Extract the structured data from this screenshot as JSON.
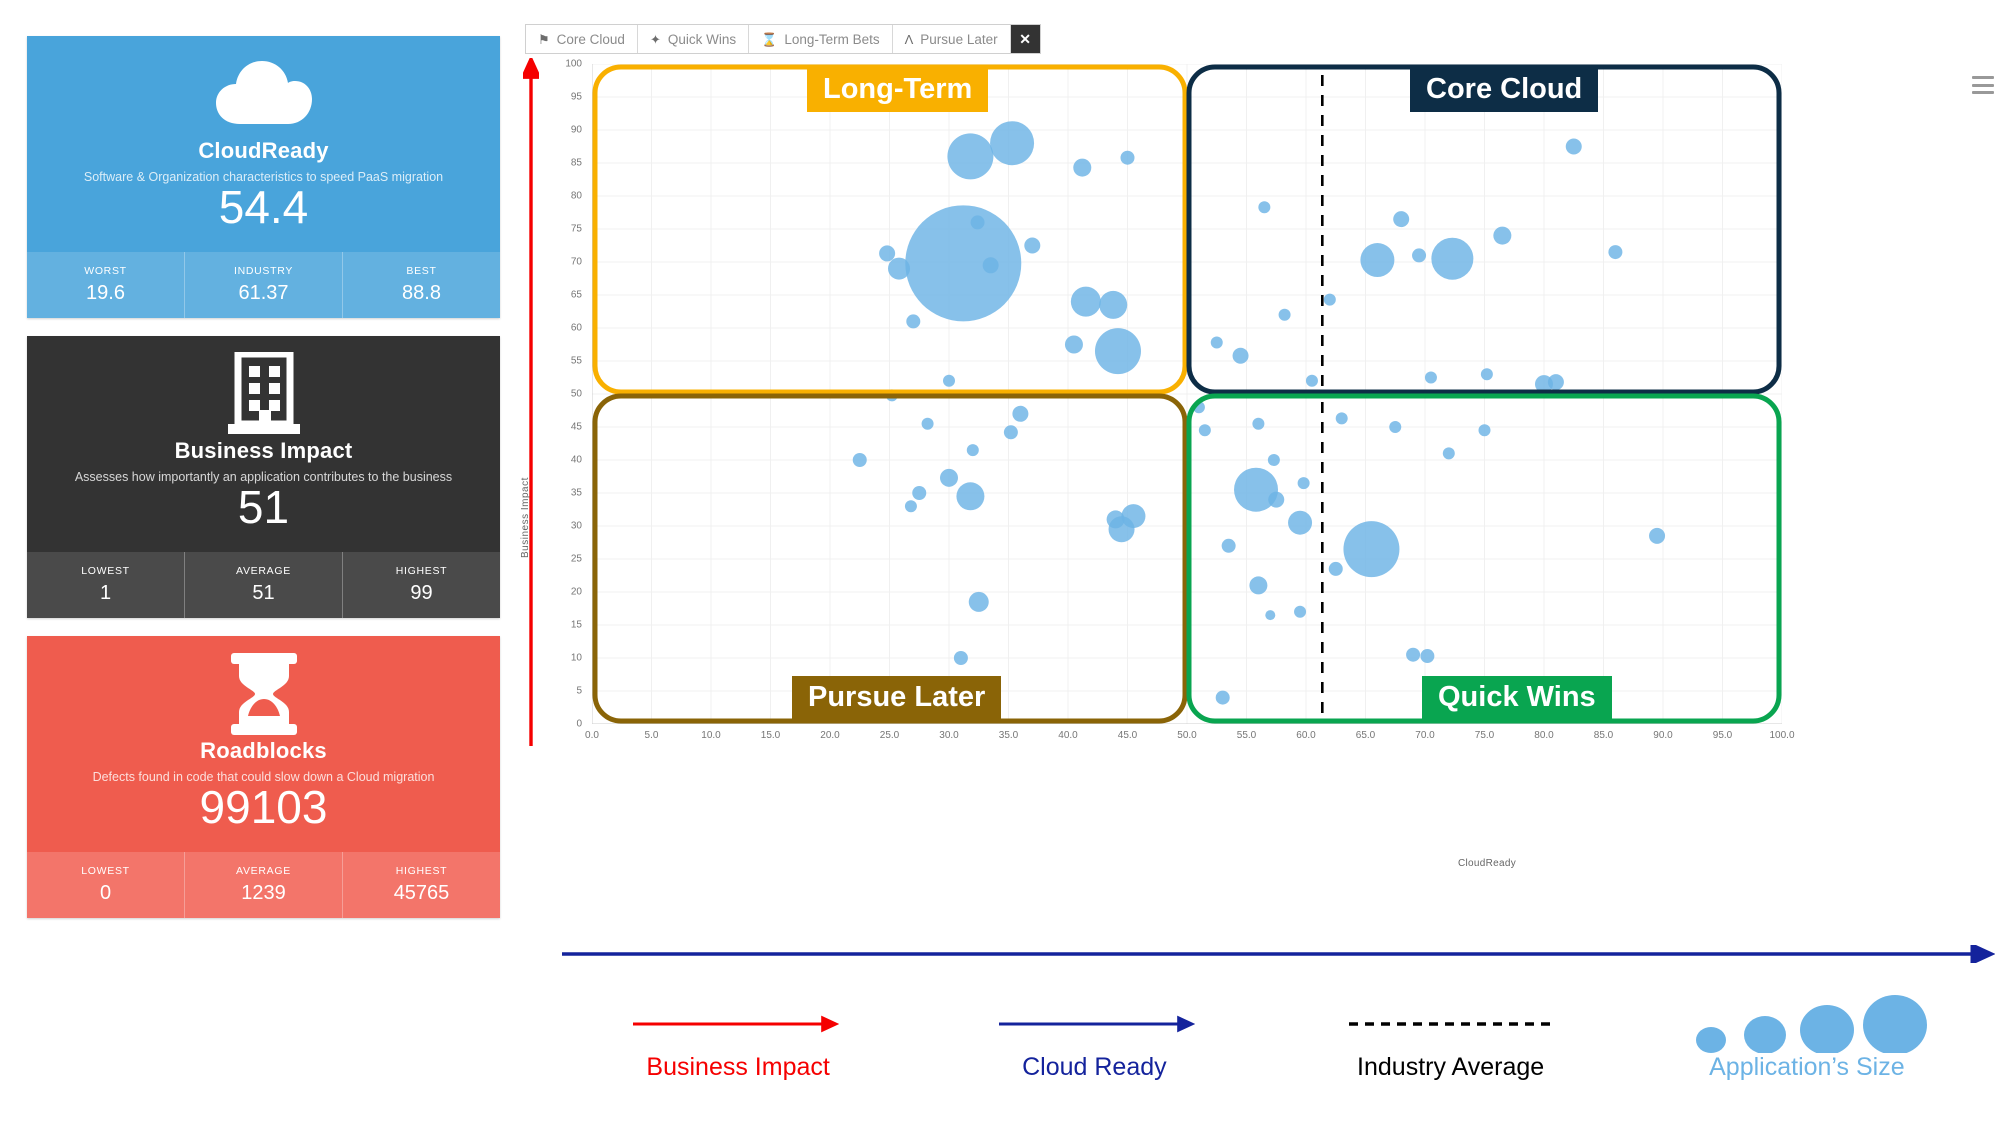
{
  "cards": [
    {
      "id": "cloudready",
      "icon": "cloud-icon",
      "title": "CloudReady",
      "subtitle": "Software & Organization characteristics to speed PaaS migration",
      "value": "54.4",
      "color": "#49a4db",
      "stats": [
        {
          "label": "WORST",
          "value": "19.6"
        },
        {
          "label": "INDUSTRY",
          "value": "61.37"
        },
        {
          "label": "BEST",
          "value": "88.8"
        }
      ]
    },
    {
      "id": "business-impact",
      "icon": "building-icon",
      "title": "Business Impact",
      "subtitle": "Assesses how importantly an application contributes to the business",
      "value": "51",
      "color": "#333333",
      "stats": [
        {
          "label": "LOWEST",
          "value": "1"
        },
        {
          "label": "AVERAGE",
          "value": "51"
        },
        {
          "label": "HIGHEST",
          "value": "99"
        }
      ]
    },
    {
      "id": "roadblocks",
      "icon": "hourglass-icon",
      "title": "Roadblocks",
      "subtitle": "Defects found in code that could slow down a Cloud migration",
      "value": "99103",
      "color": "#ef5c4e",
      "stats": [
        {
          "label": "LOWEST",
          "value": "0"
        },
        {
          "label": "AVERAGE",
          "value": "1239"
        },
        {
          "label": "HIGHEST",
          "value": "45765"
        }
      ]
    }
  ],
  "toolbar": {
    "buttons": [
      {
        "icon": "flag-icon",
        "glyph": "⚑",
        "label": "Core Cloud"
      },
      {
        "icon": "magic-wand-icon",
        "glyph": "✦",
        "label": "Quick Wins"
      },
      {
        "icon": "hourglass-icon",
        "glyph": "⌛",
        "label": "Long-Term Bets"
      },
      {
        "icon": "binoculars-icon",
        "glyph": "Ʌ",
        "label": "Pursue Later"
      }
    ],
    "close_label": "✕"
  },
  "chart_data": {
    "type": "scatter",
    "title": "",
    "xlabel": "CloudReady",
    "ylabel": "Business Impact",
    "xlim": [
      0,
      100
    ],
    "ylim": [
      0,
      100
    ],
    "grid": true,
    "xticks": [
      "0.0",
      "5.0",
      "10.0",
      "15.0",
      "20.0",
      "25.0",
      "30.0",
      "35.0",
      "40.0",
      "45.0",
      "50.0",
      "55.0",
      "60.0",
      "65.0",
      "70.0",
      "75.0",
      "80.0",
      "85.0",
      "90.0",
      "95.0",
      "100.0"
    ],
    "yticks": [
      "0",
      "5",
      "10",
      "15",
      "20",
      "25",
      "30",
      "35",
      "40",
      "45",
      "50",
      "55",
      "60",
      "65",
      "70",
      "75",
      "80",
      "85",
      "90",
      "95",
      "100"
    ],
    "industry_average_x": 61.37,
    "bubble_color": "#6cb3e5",
    "quadrants": [
      {
        "id": "long-term",
        "label": "Long-Term",
        "color": "#f9b000",
        "x_range": [
          0,
          50
        ],
        "y_range": [
          50,
          100
        ]
      },
      {
        "id": "core-cloud",
        "label": "Core Cloud",
        "color": "#0d2d46",
        "x_range": [
          50,
          100
        ],
        "y_range": [
          50,
          100
        ]
      },
      {
        "id": "pursue-later",
        "label": "Pursue Later",
        "color": "#8a6407",
        "x_range": [
          0,
          50
        ],
        "y_range": [
          0,
          50
        ]
      },
      {
        "id": "quick-wins",
        "label": "Quick Wins",
        "color": "#09a550",
        "x_range": [
          50,
          100
        ],
        "y_range": [
          0,
          50
        ]
      }
    ],
    "points": [
      {
        "x": 31.8,
        "y": 86.0,
        "r": 23
      },
      {
        "x": 35.3,
        "y": 88.0,
        "r": 22
      },
      {
        "x": 41.2,
        "y": 84.3,
        "r": 9
      },
      {
        "x": 45.0,
        "y": 85.8,
        "r": 7
      },
      {
        "x": 32.4,
        "y": 76.0,
        "r": 7
      },
      {
        "x": 31.2,
        "y": 69.8,
        "r": 58
      },
      {
        "x": 37.0,
        "y": 72.5,
        "r": 8
      },
      {
        "x": 24.8,
        "y": 71.3,
        "r": 8
      },
      {
        "x": 25.8,
        "y": 69.0,
        "r": 11
      },
      {
        "x": 33.5,
        "y": 69.5,
        "r": 8
      },
      {
        "x": 41.5,
        "y": 64.0,
        "r": 15
      },
      {
        "x": 43.8,
        "y": 63.5,
        "r": 14
      },
      {
        "x": 27.0,
        "y": 61.0,
        "r": 7
      },
      {
        "x": 44.2,
        "y": 56.5,
        "r": 23
      },
      {
        "x": 40.5,
        "y": 57.5,
        "r": 9
      },
      {
        "x": 30.0,
        "y": 52.0,
        "r": 6
      },
      {
        "x": 25.2,
        "y": 49.8,
        "r": 6
      },
      {
        "x": 36.0,
        "y": 47.0,
        "r": 8
      },
      {
        "x": 35.2,
        "y": 44.2,
        "r": 7
      },
      {
        "x": 28.2,
        "y": 45.5,
        "r": 6
      },
      {
        "x": 22.5,
        "y": 40.0,
        "r": 7
      },
      {
        "x": 32.0,
        "y": 41.5,
        "r": 6
      },
      {
        "x": 30.0,
        "y": 37.3,
        "r": 9
      },
      {
        "x": 27.5,
        "y": 35.0,
        "r": 7
      },
      {
        "x": 31.8,
        "y": 34.5,
        "r": 14
      },
      {
        "x": 26.8,
        "y": 33.0,
        "r": 6
      },
      {
        "x": 44.0,
        "y": 31.0,
        "r": 9
      },
      {
        "x": 45.5,
        "y": 31.5,
        "r": 12
      },
      {
        "x": 44.5,
        "y": 29.5,
        "r": 13
      },
      {
        "x": 32.5,
        "y": 18.5,
        "r": 10
      },
      {
        "x": 31.0,
        "y": 10.0,
        "r": 7
      },
      {
        "x": 51.5,
        "y": 44.5,
        "r": 6
      },
      {
        "x": 55.8,
        "y": 35.5,
        "r": 22
      },
      {
        "x": 57.5,
        "y": 34.0,
        "r": 8
      },
      {
        "x": 59.8,
        "y": 36.5,
        "r": 6
      },
      {
        "x": 59.5,
        "y": 30.5,
        "r": 12
      },
      {
        "x": 65.5,
        "y": 26.5,
        "r": 28
      },
      {
        "x": 53.5,
        "y": 27.0,
        "r": 7
      },
      {
        "x": 56.0,
        "y": 21.0,
        "r": 9
      },
      {
        "x": 62.5,
        "y": 23.5,
        "r": 7
      },
      {
        "x": 59.5,
        "y": 17.0,
        "r": 6
      },
      {
        "x": 69.0,
        "y": 10.5,
        "r": 7
      },
      {
        "x": 70.2,
        "y": 10.3,
        "r": 7
      },
      {
        "x": 53.0,
        "y": 4.0,
        "r": 7
      },
      {
        "x": 89.5,
        "y": 28.5,
        "r": 8
      },
      {
        "x": 51.0,
        "y": 48.0,
        "r": 6
      },
      {
        "x": 60.5,
        "y": 52.0,
        "r": 6
      },
      {
        "x": 70.5,
        "y": 52.5,
        "r": 6
      },
      {
        "x": 80.0,
        "y": 51.5,
        "r": 9
      },
      {
        "x": 81.0,
        "y": 51.8,
        "r": 8
      },
      {
        "x": 75.2,
        "y": 53.0,
        "r": 6
      },
      {
        "x": 54.5,
        "y": 55.8,
        "r": 8
      },
      {
        "x": 52.5,
        "y": 57.8,
        "r": 6
      },
      {
        "x": 58.2,
        "y": 62.0,
        "r": 6
      },
      {
        "x": 62.0,
        "y": 64.3,
        "r": 6
      },
      {
        "x": 66.0,
        "y": 70.3,
        "r": 17
      },
      {
        "x": 69.5,
        "y": 71.0,
        "r": 7
      },
      {
        "x": 72.3,
        "y": 70.5,
        "r": 21
      },
      {
        "x": 86.0,
        "y": 71.5,
        "r": 7
      },
      {
        "x": 76.5,
        "y": 74.0,
        "r": 9
      },
      {
        "x": 68.0,
        "y": 76.5,
        "r": 8
      },
      {
        "x": 56.5,
        "y": 78.3,
        "r": 6
      },
      {
        "x": 82.5,
        "y": 87.5,
        "r": 8
      },
      {
        "x": 56.0,
        "y": 45.5,
        "r": 6
      },
      {
        "x": 63.0,
        "y": 46.3,
        "r": 6
      },
      {
        "x": 67.5,
        "y": 45.0,
        "r": 6
      },
      {
        "x": 75.0,
        "y": 44.5,
        "r": 6
      },
      {
        "x": 72.0,
        "y": 41.0,
        "r": 6
      },
      {
        "x": 57.3,
        "y": 40.0,
        "r": 6
      },
      {
        "x": 57.0,
        "y": 16.5,
        "r": 5
      }
    ]
  },
  "legend": [
    {
      "id": "business-impact",
      "art": "red-arrow",
      "label": "Business Impact",
      "color": "#f50000"
    },
    {
      "id": "cloud-ready",
      "art": "navy-arrow",
      "label": "Cloud Ready",
      "color": "#14239c"
    },
    {
      "id": "industry-average",
      "art": "dashed-line",
      "label": "Industry Average",
      "color": "#000000"
    },
    {
      "id": "application-size",
      "art": "bubble-scale",
      "label": "Application’s Size",
      "color": "#6cb3e5"
    }
  ]
}
